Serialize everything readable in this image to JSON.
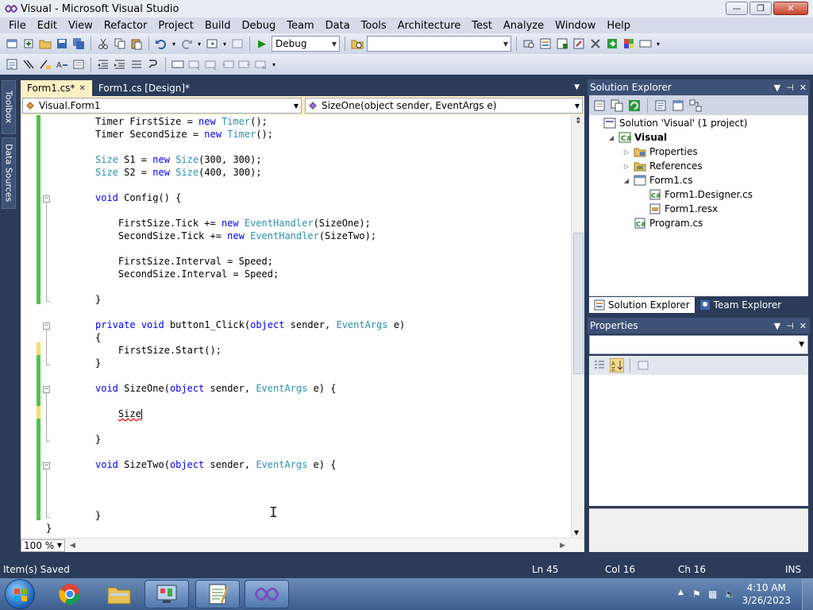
{
  "window": {
    "title": "Visual - Microsoft Visual Studio",
    "controls": {
      "minimize": "—",
      "maximize": "❐",
      "close": "✕"
    }
  },
  "menu": [
    "File",
    "Edit",
    "View",
    "Refactor",
    "Project",
    "Build",
    "Debug",
    "Team",
    "Data",
    "Tools",
    "Architecture",
    "Test",
    "Analyze",
    "Window",
    "Help"
  ],
  "toolbar": {
    "config_value": "Debug",
    "platform_value": ""
  },
  "side_tabs": [
    "Toolbox",
    "Data Sources"
  ],
  "editor": {
    "tabs": [
      {
        "label": "Form1.cs*",
        "active": true
      },
      {
        "label": "Form1.cs [Design]*",
        "active": false
      }
    ],
    "nav_class": "Visual.Form1",
    "nav_member": "SizeOne(object sender, EventArgs e)",
    "zoom": "100 %",
    "lines": [
      [
        [
          "",
          "Timer FirstSize = "
        ],
        [
          "kw",
          "new"
        ],
        [
          "",
          " "
        ],
        [
          "ty",
          "Timer"
        ],
        [
          "",
          "();"
        ]
      ],
      [
        [
          "",
          "Timer SecondSize = "
        ],
        [
          "kw",
          "new"
        ],
        [
          "",
          " "
        ],
        [
          "ty",
          "Timer"
        ],
        [
          "",
          "();"
        ]
      ],
      [],
      [
        [
          "ty",
          "Size"
        ],
        [
          "",
          " S1 = "
        ],
        [
          "kw",
          "new"
        ],
        [
          "",
          " "
        ],
        [
          "ty",
          "Size"
        ],
        [
          "",
          "(300, 300);"
        ]
      ],
      [
        [
          "ty",
          "Size"
        ],
        [
          "",
          " S2 = "
        ],
        [
          "kw",
          "new"
        ],
        [
          "",
          " "
        ],
        [
          "ty",
          "Size"
        ],
        [
          "",
          "(400, 300);"
        ]
      ],
      [],
      [
        [
          "kw",
          "void"
        ],
        [
          "",
          " Config() {"
        ]
      ],
      [],
      [
        [
          "",
          "    FirstSize.Tick += "
        ],
        [
          "kw",
          "new"
        ],
        [
          "",
          " "
        ],
        [
          "ty",
          "EventHandler"
        ],
        [
          "",
          "(SizeOne);"
        ]
      ],
      [
        [
          "",
          "    SecondSize.Tick += "
        ],
        [
          "kw",
          "new"
        ],
        [
          "",
          " "
        ],
        [
          "ty",
          "EventHandler"
        ],
        [
          "",
          "(SizeTwo);"
        ]
      ],
      [],
      [
        [
          "",
          "    FirstSize.Interval = Speed;"
        ]
      ],
      [
        [
          "",
          "    SecondSize.Interval = Speed;"
        ]
      ],
      [],
      [
        [
          "",
          "}"
        ]
      ],
      [],
      [
        [
          "kw",
          "private"
        ],
        [
          "",
          " "
        ],
        [
          "kw",
          "void"
        ],
        [
          "",
          " button1_Click("
        ],
        [
          "kw",
          "object"
        ],
        [
          "",
          " sender, "
        ],
        [
          "ty",
          "EventArgs"
        ],
        [
          "",
          " e)"
        ]
      ],
      [
        [
          "",
          "{"
        ]
      ],
      [
        [
          "",
          "    FirstSize.Start();"
        ]
      ],
      [
        [
          "",
          "}"
        ]
      ],
      [],
      [
        [
          "kw",
          "void"
        ],
        [
          "",
          " SizeOne("
        ],
        [
          "kw",
          "object"
        ],
        [
          "",
          " sender, "
        ],
        [
          "ty",
          "EventArgs"
        ],
        [
          "",
          " e) {"
        ]
      ],
      [],
      [
        [
          "",
          "    "
        ],
        [
          "sq",
          "Size"
        ],
        [
          "caret",
          ""
        ]
      ],
      [],
      [
        [
          "",
          "}"
        ]
      ],
      [],
      [
        [
          "kw",
          "void"
        ],
        [
          "",
          " SizeTwo("
        ],
        [
          "kw",
          "object"
        ],
        [
          "",
          " sender, "
        ],
        [
          "ty",
          "EventArgs"
        ],
        [
          "",
          " e) {"
        ]
      ],
      [],
      [],
      [],
      [
        [
          "",
          "}"
        ]
      ],
      [
        [
          "",
          "}"
        ]
      ]
    ]
  },
  "solution_explorer": {
    "title": "Solution Explorer",
    "tree": [
      {
        "label": "Solution 'Visual' (1 project)",
        "level": 0,
        "expander": "",
        "icon": "solution-icon"
      },
      {
        "label": "Visual",
        "level": 1,
        "expander": "◢",
        "icon": "csharp-project-icon",
        "bold": true
      },
      {
        "label": "Properties",
        "level": 2,
        "expander": "▷",
        "icon": "properties-folder-icon"
      },
      {
        "label": "References",
        "level": 2,
        "expander": "▷",
        "icon": "references-icon"
      },
      {
        "label": "Form1.cs",
        "level": 2,
        "expander": "◢",
        "icon": "form-icon"
      },
      {
        "label": "Form1.Designer.cs",
        "level": 3,
        "expander": "",
        "icon": "cs-file-icon"
      },
      {
        "label": "Form1.resx",
        "level": 3,
        "expander": "",
        "icon": "resx-file-icon"
      },
      {
        "label": "Program.cs",
        "level": 2,
        "expander": "",
        "icon": "cs-file-icon"
      }
    ],
    "tabs": [
      "Solution Explorer",
      "Team Explorer"
    ]
  },
  "properties": {
    "title": "Properties"
  },
  "status": {
    "message": "Item(s) Saved",
    "ln": "Ln 45",
    "col": "Col 16",
    "ch": "Ch 16",
    "mode": "INS"
  },
  "taskbar": {
    "time": "4:10 AM",
    "date": "3/26/2023"
  }
}
